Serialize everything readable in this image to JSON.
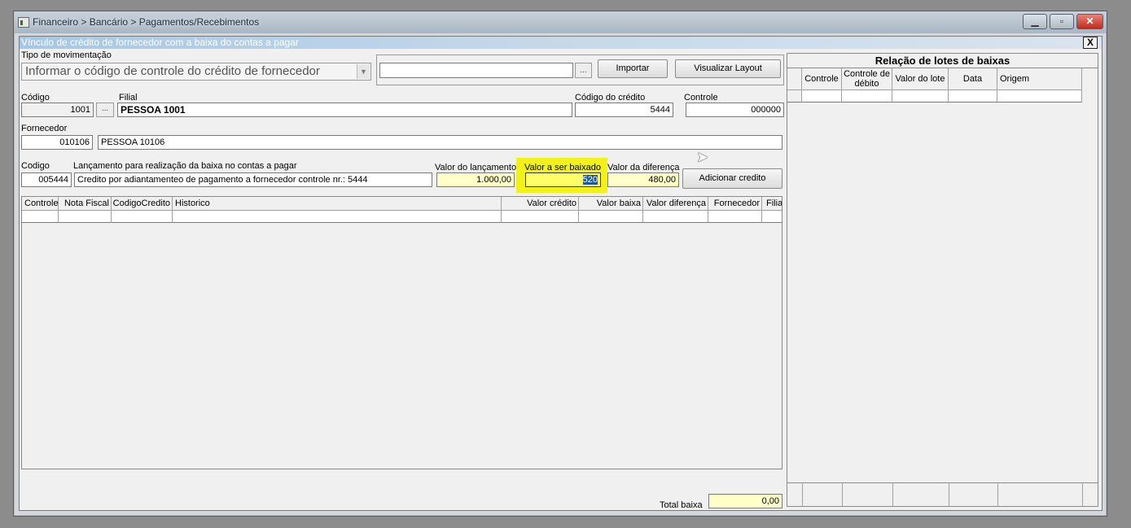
{
  "window": {
    "breadcrumb": "Financeiro > Bancário > Pagamentos/Recebimentos",
    "minimize_icon": "minimize-icon",
    "maximize_icon": "maximize-icon",
    "close_icon": "close-icon"
  },
  "dialog": {
    "title": "Vínculo de crédito de fornecedor com a baixa do contas a pagar",
    "close_label": "X"
  },
  "tipo": {
    "label": "Tipo de  movimentação",
    "value": "Informar o código de controle do crédito de fornecedor"
  },
  "import": {
    "path_value": "",
    "browse_label": "...",
    "import_label": "Importar",
    "layout_label": "Visualizar Layout"
  },
  "codigo": {
    "label": "Código",
    "value": "1001",
    "button": "..."
  },
  "filial": {
    "label": "Filial",
    "value": "PESSOA 1001"
  },
  "codigo_credito": {
    "label": "Código do crédito",
    "value": "5444"
  },
  "controle": {
    "label": "Controle",
    "value": "000000"
  },
  "fornecedor": {
    "label": "Fornecedor",
    "code": "010106",
    "name": "PESSOA 10106"
  },
  "lancamento": {
    "codigo_label": "Codigo",
    "codigo_value": "005444",
    "label": "Lançamento para realização da baixa no contas a pagar",
    "value": "Credito por adiantamenteo de pagamento a fornecedor controle nr.: 5444",
    "valor_lancamento_label": "Valor do lançamento",
    "valor_lancamento": "1.000,00",
    "valor_baixado_label": "Valor a ser baixado",
    "valor_baixado": "520",
    "valor_diferenca_label": "Valor da diferença",
    "valor_diferenca": "480,00",
    "add_button": "Adicionar credito"
  },
  "credits_table": {
    "headers": [
      "Controle",
      "Nota Fiscal",
      "CodigoCredito",
      "Historico",
      "Valor crédito",
      "Valor baixa",
      "Valor diferença",
      "Fornecedor",
      "Filia"
    ]
  },
  "total": {
    "label": "Total baixa",
    "value": "0,00"
  },
  "lotes": {
    "title": "Relação de lotes de baixas",
    "headers": [
      "Controle",
      "Controle de débito",
      "Valor do lote",
      "Data",
      "Origem"
    ]
  },
  "colors": {
    "highlight": "#f2f21a",
    "yellow_field": "#ffffc8",
    "dialog_title": "#a6c8e4"
  }
}
